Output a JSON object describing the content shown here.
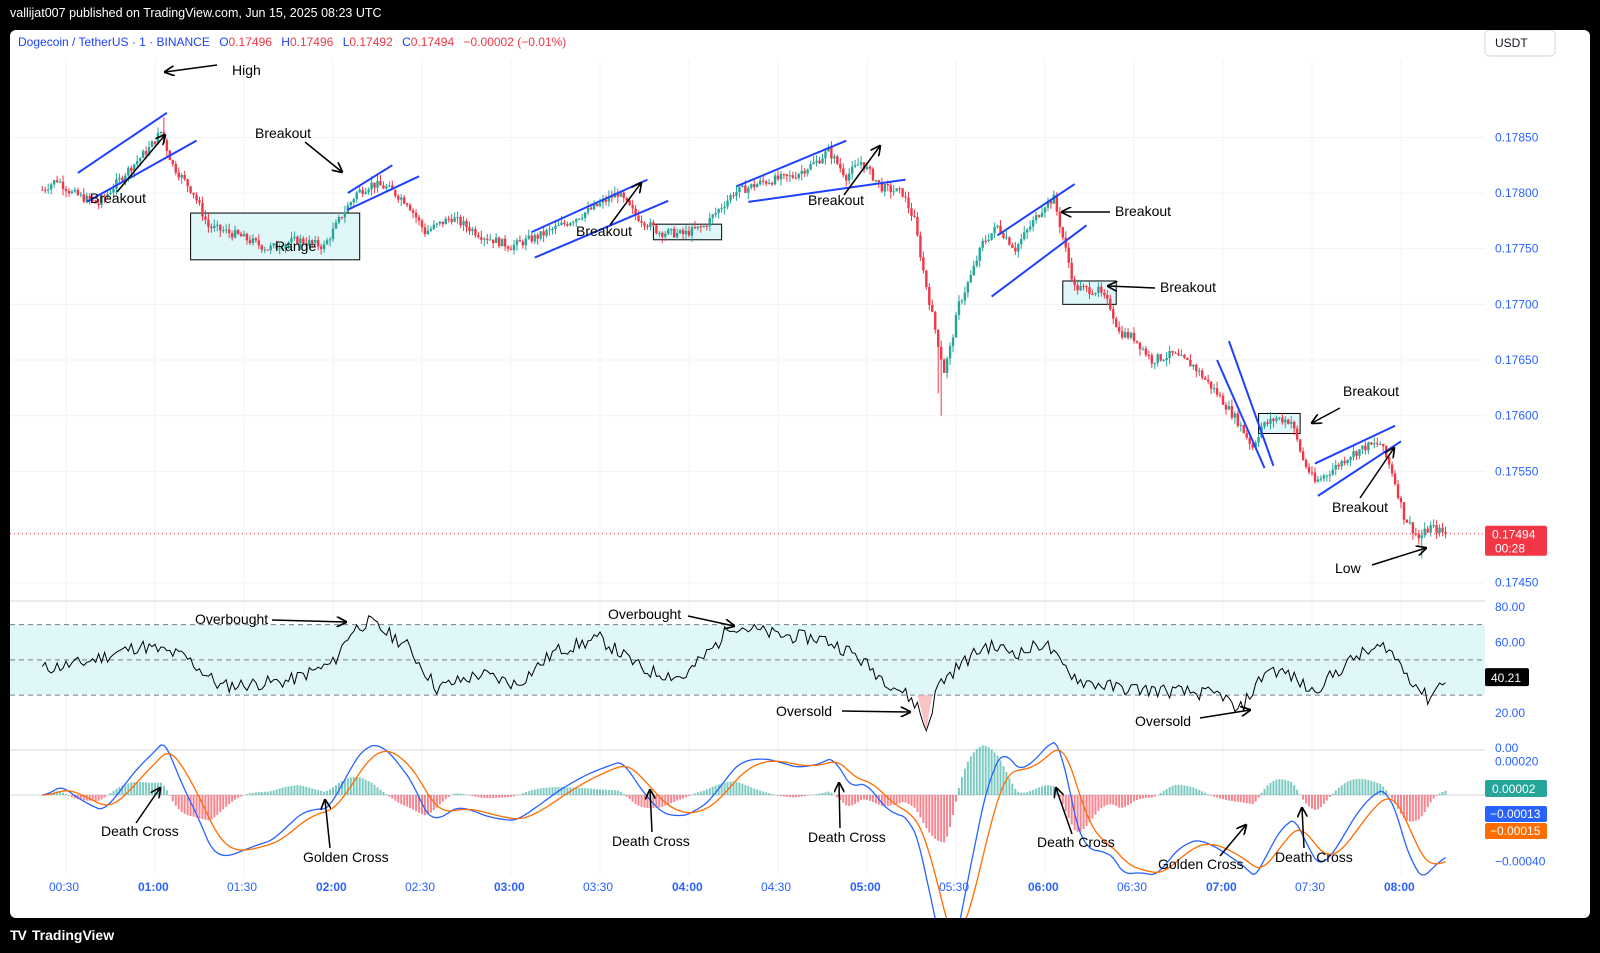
{
  "header": {
    "published": "vallijat007 published on TradingView.com, Jun 15, 2025 08:23 UTC"
  },
  "footer": {
    "brand": "TradingView"
  },
  "legend": {
    "symbol": "Dogecoin / TetherUS · 1 · BINANCE",
    "open_label": "O",
    "open": "0.17496",
    "high_label": "H",
    "high": "0.17496",
    "low_label": "L",
    "low": "0.17492",
    "close_label": "C",
    "close": "0.17494",
    "change": "−0.00002 (−0.01%)"
  },
  "currency_label": "USDT",
  "colors": {
    "up": "#26a69a",
    "down": "#f23645",
    "trend": "#1e40ff",
    "rsi_band": "#e0f7fa",
    "macd_line": "#2962ff",
    "signal_line": "#ff6d00",
    "text_axis": "#2962ff"
  },
  "price_badge": {
    "value": "0.17494",
    "countdown": "00:28"
  },
  "rsi_badge": "40.21",
  "macd_badges": {
    "hist": "0.00002",
    "macd": "−0.00013",
    "signal": "−0.00015"
  },
  "chart_data": {
    "type": "candlestick",
    "title": "Dogecoin / TetherUS · 1 · BINANCE",
    "x_ticks": [
      "00:30",
      "01:00",
      "01:30",
      "02:00",
      "02:30",
      "03:00",
      "03:30",
      "04:00",
      "04:30",
      "05:00",
      "05:30",
      "06:00",
      "06:30",
      "07:00",
      "07:30",
      "08:00"
    ],
    "x_bold_ticks": [
      "01:00",
      "02:00",
      "03:00",
      "04:00",
      "05:00",
      "06:00",
      "07:00",
      "08:00"
    ],
    "price_ticks": [
      "0.17850",
      "0.17800",
      "0.17750",
      "0.17700",
      "0.17650",
      "0.17600",
      "0.17550",
      "0.17450"
    ],
    "price_ylim": [
      0.17437,
      0.17897
    ],
    "price_path_keypoints": [
      {
        "t": "00:22",
        "p": 0.17803
      },
      {
        "t": "00:27",
        "p": 0.17812
      },
      {
        "t": "00:32",
        "p": 0.178
      },
      {
        "t": "00:41",
        "p": 0.1779
      },
      {
        "t": "00:50",
        "p": 0.17818
      },
      {
        "t": "00:58",
        "p": 0.1784
      },
      {
        "t": "01:02",
        "p": 0.17855
      },
      {
        "t": "01:06",
        "p": 0.17825
      },
      {
        "t": "01:13",
        "p": 0.178
      },
      {
        "t": "01:18",
        "p": 0.1777
      },
      {
        "t": "01:28",
        "p": 0.17762
      },
      {
        "t": "01:38",
        "p": 0.1775
      },
      {
        "t": "01:48",
        "p": 0.17758
      },
      {
        "t": "01:57",
        "p": 0.17752
      },
      {
        "t": "02:03",
        "p": 0.1778
      },
      {
        "t": "02:08",
        "p": 0.178
      },
      {
        "t": "02:13",
        "p": 0.17808
      },
      {
        "t": "02:18",
        "p": 0.17805
      },
      {
        "t": "02:25",
        "p": 0.17792
      },
      {
        "t": "02:31",
        "p": 0.17765
      },
      {
        "t": "02:40",
        "p": 0.17778
      },
      {
        "t": "02:50",
        "p": 0.17762
      },
      {
        "t": "03:00",
        "p": 0.17752
      },
      {
        "t": "03:10",
        "p": 0.17762
      },
      {
        "t": "03:20",
        "p": 0.17775
      },
      {
        "t": "03:30",
        "p": 0.1779
      },
      {
        "t": "03:36",
        "p": 0.178
      },
      {
        "t": "03:42",
        "p": 0.1778
      },
      {
        "t": "03:50",
        "p": 0.17765
      },
      {
        "t": "03:58",
        "p": 0.17763
      },
      {
        "t": "04:05",
        "p": 0.1777
      },
      {
        "t": "04:15",
        "p": 0.178
      },
      {
        "t": "04:25",
        "p": 0.1781
      },
      {
        "t": "04:35",
        "p": 0.17815
      },
      {
        "t": "04:43",
        "p": 0.17828
      },
      {
        "t": "04:47",
        "p": 0.17838
      },
      {
        "t": "04:53",
        "p": 0.17815
      },
      {
        "t": "04:58",
        "p": 0.17828
      },
      {
        "t": "05:05",
        "p": 0.17805
      },
      {
        "t": "05:12",
        "p": 0.178
      },
      {
        "t": "05:16",
        "p": 0.17775
      },
      {
        "t": "05:19",
        "p": 0.1773
      },
      {
        "t": "05:22",
        "p": 0.1769
      },
      {
        "t": "05:26",
        "p": 0.1764
      },
      {
        "t": "05:28",
        "p": 0.1766
      },
      {
        "t": "05:31",
        "p": 0.177
      },
      {
        "t": "05:35",
        "p": 0.17725
      },
      {
        "t": "05:39",
        "p": 0.17755
      },
      {
        "t": "05:44",
        "p": 0.1777
      },
      {
        "t": "05:50",
        "p": 0.1775
      },
      {
        "t": "05:55",
        "p": 0.1777
      },
      {
        "t": "06:00",
        "p": 0.1779
      },
      {
        "t": "06:03",
        "p": 0.17795
      },
      {
        "t": "06:06",
        "p": 0.1776
      },
      {
        "t": "06:10",
        "p": 0.17715
      },
      {
        "t": "06:18",
        "p": 0.17712
      },
      {
        "t": "06:22",
        "p": 0.17698
      },
      {
        "t": "06:25",
        "p": 0.17675
      },
      {
        "t": "06:30",
        "p": 0.1767
      },
      {
        "t": "06:36",
        "p": 0.1765
      },
      {
        "t": "06:43",
        "p": 0.17655
      },
      {
        "t": "06:50",
        "p": 0.17645
      },
      {
        "t": "06:58",
        "p": 0.1762
      },
      {
        "t": "07:05",
        "p": 0.17595
      },
      {
        "t": "07:10",
        "p": 0.17572
      },
      {
        "t": "07:13",
        "p": 0.1759
      },
      {
        "t": "07:18",
        "p": 0.17598
      },
      {
        "t": "07:23",
        "p": 0.17595
      },
      {
        "t": "07:27",
        "p": 0.1756
      },
      {
        "t": "07:31",
        "p": 0.1754
      },
      {
        "t": "07:37",
        "p": 0.17552
      },
      {
        "t": "07:43",
        "p": 0.17565
      },
      {
        "t": "07:48",
        "p": 0.17572
      },
      {
        "t": "07:53",
        "p": 0.17575
      },
      {
        "t": "07:57",
        "p": 0.1755
      },
      {
        "t": "08:01",
        "p": 0.1751
      },
      {
        "t": "08:06",
        "p": 0.1749
      },
      {
        "t": "08:10",
        "p": 0.175
      },
      {
        "t": "08:15",
        "p": 0.17494
      }
    ],
    "last_price": 0.17494,
    "annotations": [
      "High",
      "Breakout",
      "Breakout",
      "Range",
      "Breakout",
      "Breakout",
      "Breakout",
      "Breakout",
      "Breakout",
      "Breakout",
      "Breakout",
      "Low"
    ],
    "rsi": {
      "ticks": [
        "80.00",
        "60.00",
        "20.00",
        "0.00"
      ],
      "ylim": [
        0,
        80
      ],
      "bands": [
        70,
        50,
        30
      ],
      "keypoints": [
        {
          "t": "00:22",
          "v": 45
        },
        {
          "t": "00:35",
          "v": 48
        },
        {
          "t": "00:55",
          "v": 58
        },
        {
          "t": "01:10",
          "v": 52
        },
        {
          "t": "01:22",
          "v": 35
        },
        {
          "t": "01:45",
          "v": 38
        },
        {
          "t": "02:00",
          "v": 48
        },
        {
          "t": "02:06",
          "v": 66
        },
        {
          "t": "02:12",
          "v": 72
        },
        {
          "t": "02:25",
          "v": 58
        },
        {
          "t": "02:35",
          "v": 34
        },
        {
          "t": "02:50",
          "v": 42
        },
        {
          "t": "03:02",
          "v": 36
        },
        {
          "t": "03:15",
          "v": 55
        },
        {
          "t": "03:30",
          "v": 62
        },
        {
          "t": "03:45",
          "v": 44
        },
        {
          "t": "03:58",
          "v": 40
        },
        {
          "t": "04:10",
          "v": 60
        },
        {
          "t": "04:14",
          "v": 70
        },
        {
          "t": "04:30",
          "v": 64
        },
        {
          "t": "04:45",
          "v": 62
        },
        {
          "t": "04:55",
          "v": 54
        },
        {
          "t": "05:05",
          "v": 40
        },
        {
          "t": "05:12",
          "v": 32
        },
        {
          "t": "05:17",
          "v": 24
        },
        {
          "t": "05:20",
          "v": 10
        },
        {
          "t": "05:24",
          "v": 36
        },
        {
          "t": "05:32",
          "v": 48
        },
        {
          "t": "05:40",
          "v": 58
        },
        {
          "t": "05:52",
          "v": 54
        },
        {
          "t": "06:00",
          "v": 60
        },
        {
          "t": "06:05",
          "v": 48
        },
        {
          "t": "06:12",
          "v": 38
        },
        {
          "t": "06:25",
          "v": 34
        },
        {
          "t": "06:45",
          "v": 32
        },
        {
          "t": "07:00",
          "v": 30
        },
        {
          "t": "07:05",
          "v": 20
        },
        {
          "t": "07:15",
          "v": 45
        },
        {
          "t": "07:22",
          "v": 42
        },
        {
          "t": "07:30",
          "v": 32
        },
        {
          "t": "07:45",
          "v": 52
        },
        {
          "t": "07:55",
          "v": 58
        },
        {
          "t": "08:03",
          "v": 40
        },
        {
          "t": "08:09",
          "v": 28
        },
        {
          "t": "08:15",
          "v": 40
        }
      ],
      "annotations": [
        "Overbought",
        "Overbought",
        "Oversold",
        "Oversold"
      ]
    },
    "macd": {
      "ticks": [
        "0.00020",
        "−0.00040"
      ],
      "ylim": [
        -0.00048,
        0.00024
      ],
      "annotations": [
        "Death Cross",
        "Golden Cross",
        "Death Cross",
        "Death Cross",
        "Death Cross",
        "Golden Cross",
        "Death Cross"
      ]
    }
  }
}
